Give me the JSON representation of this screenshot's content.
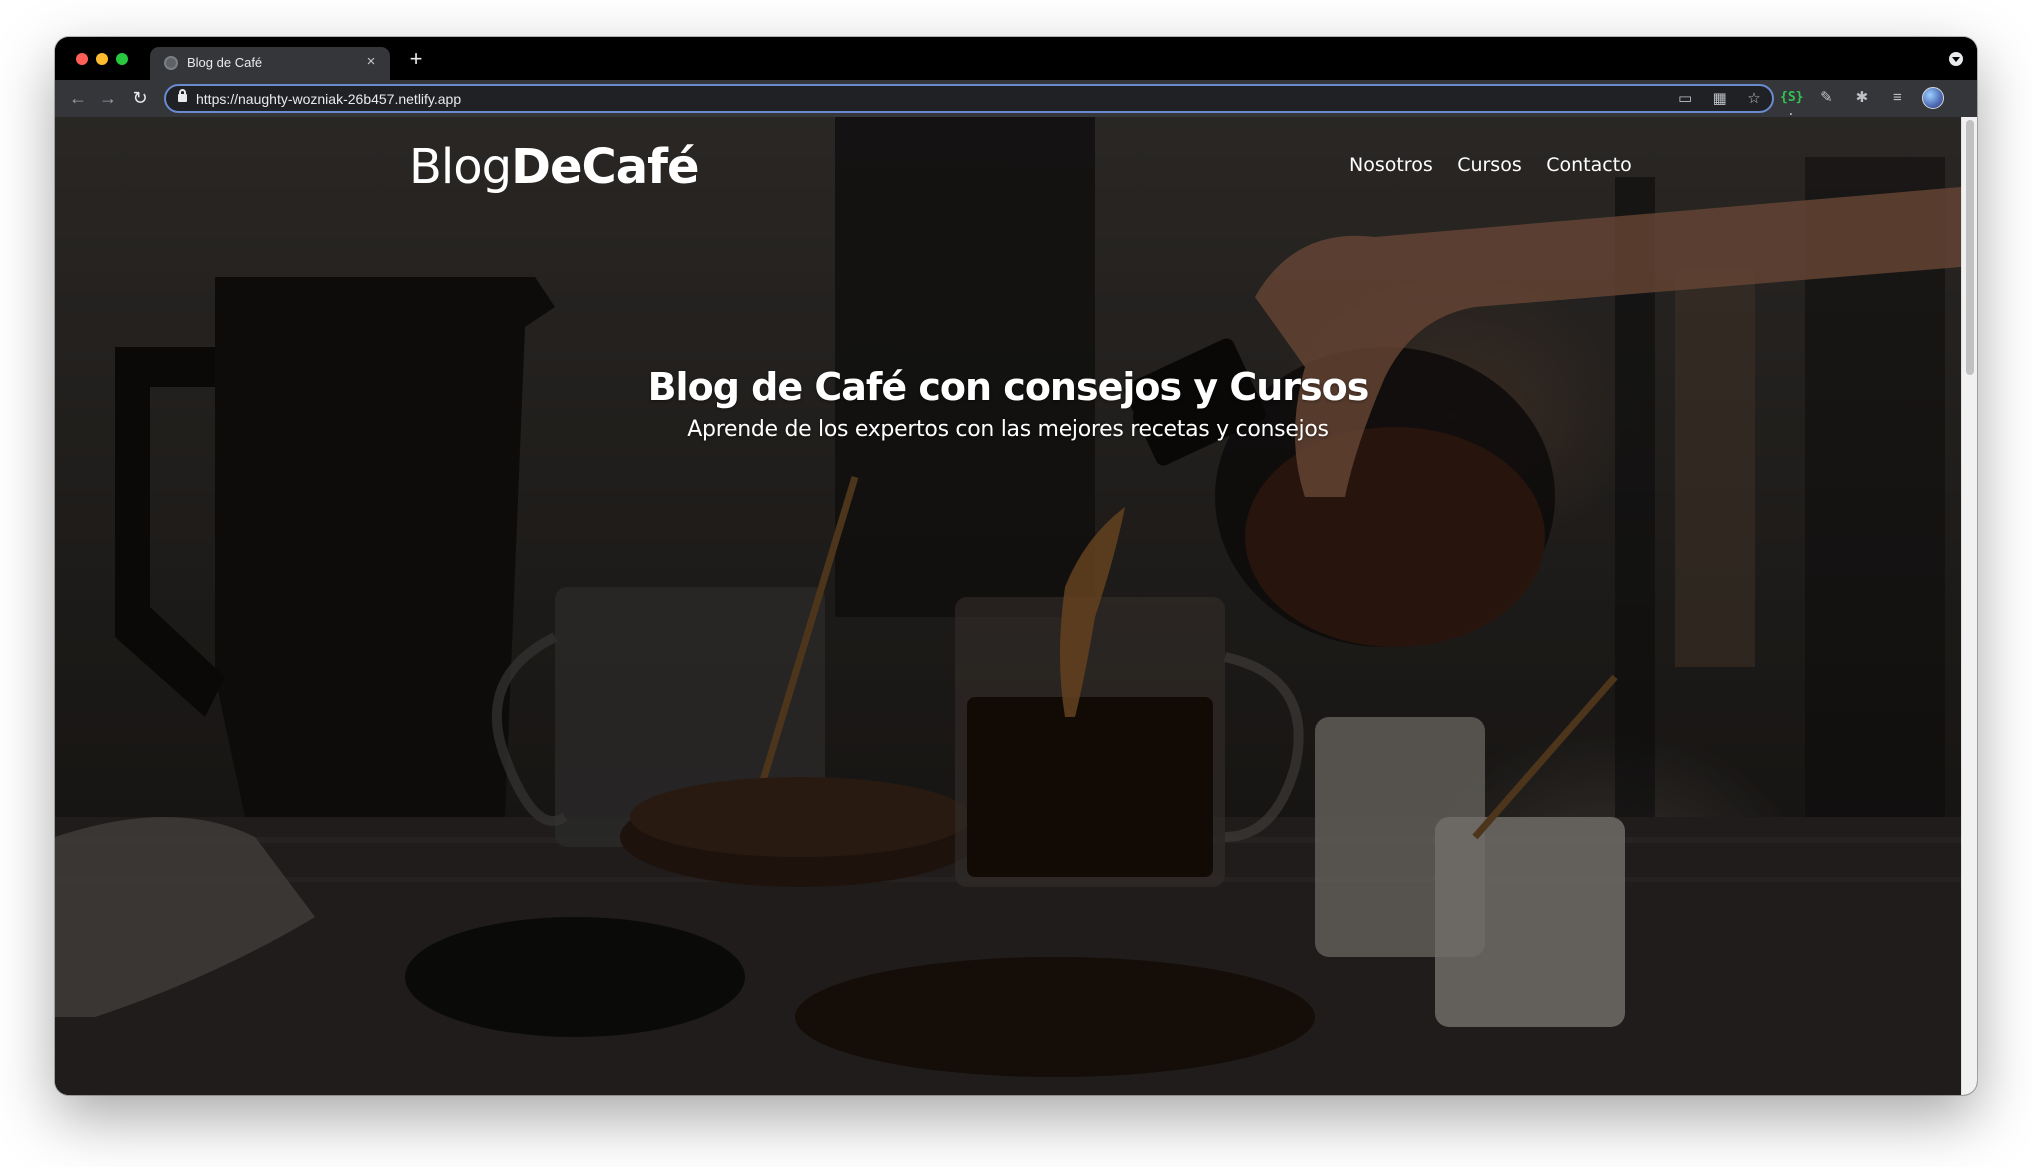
{
  "browser": {
    "tab_title": "Blog de Café",
    "url": "https://naughty-wozniak-26b457.netlify.app",
    "new_tab_label": "+",
    "close_label": "×"
  },
  "site": {
    "logo_regular": "Blog",
    "logo_bold": "DeCafé",
    "nav": [
      "Nosotros",
      "Cursos",
      "Contacto"
    ],
    "hero_title": "Blog de Café con consejos y Cursos",
    "hero_subtitle": "Aprende de los expertos con las mejores recetas y consejos"
  }
}
